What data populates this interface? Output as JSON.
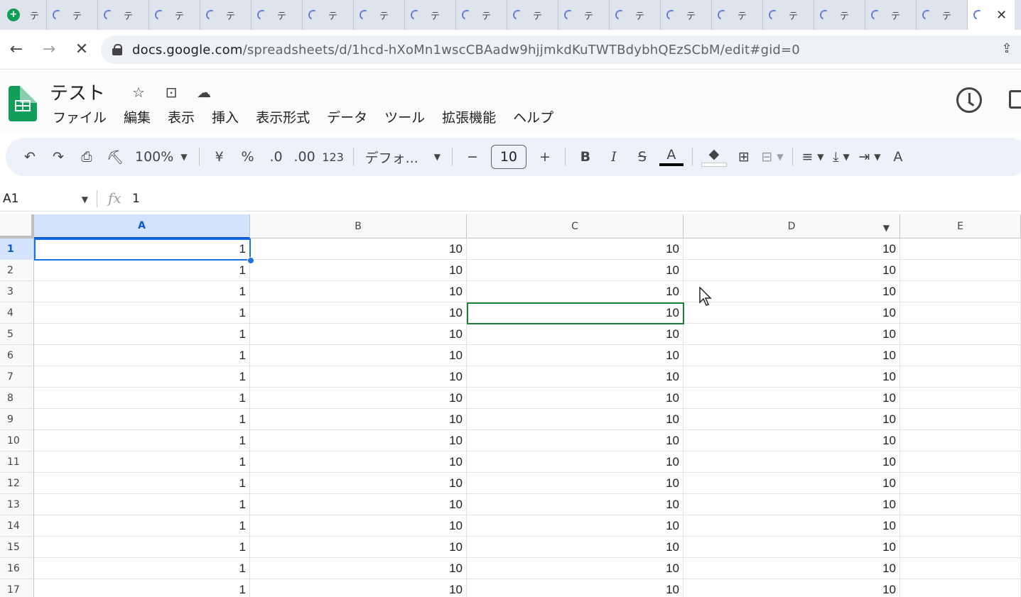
{
  "browser": {
    "tabs": [
      {
        "title": "テ",
        "loading": false,
        "active": false
      },
      {
        "title": "テ",
        "loading": true,
        "active": false
      },
      {
        "title": "テ",
        "loading": true,
        "active": false
      },
      {
        "title": "テ",
        "loading": true,
        "active": false
      },
      {
        "title": "テ",
        "loading": true,
        "active": false
      },
      {
        "title": "テ",
        "loading": true,
        "active": false
      },
      {
        "title": "テ",
        "loading": true,
        "active": false
      },
      {
        "title": "テ",
        "loading": true,
        "active": false
      },
      {
        "title": "テ",
        "loading": true,
        "active": false
      },
      {
        "title": "テ",
        "loading": true,
        "active": false
      },
      {
        "title": "テ",
        "loading": true,
        "active": false
      },
      {
        "title": "テ",
        "loading": true,
        "active": false
      },
      {
        "title": "テ",
        "loading": true,
        "active": false
      },
      {
        "title": "テ",
        "loading": true,
        "active": false
      },
      {
        "title": "テ",
        "loading": true,
        "active": false
      },
      {
        "title": "テ",
        "loading": true,
        "active": false
      },
      {
        "title": "テ",
        "loading": true,
        "active": false
      },
      {
        "title": "テ",
        "loading": true,
        "active": false
      },
      {
        "title": "テ",
        "loading": true,
        "active": false
      }
    ],
    "url_host": "docs.google.com",
    "url_path": "/spreadsheets/d/1hcd-hXoMn1wscCBAadw9hjjmkdKuTWTBdybhQEzSCbM/edit#gid=0",
    "icons": {
      "back": "←",
      "forward": "→",
      "stop": "✕",
      "close_tab": "✕",
      "share": "⇪"
    }
  },
  "doc": {
    "title": "テスト",
    "menu": [
      "ファイル",
      "編集",
      "表示",
      "挿入",
      "表示形式",
      "データ",
      "ツール",
      "拡張機能",
      "ヘルプ"
    ]
  },
  "toolbar": {
    "undo": "↶",
    "redo": "↷",
    "print": "⎙",
    "paint_format": "⛏",
    "zoom": "100%",
    "currency": "¥",
    "percent": "%",
    "decrease_decimal": ".0",
    "increase_decimal": ".00",
    "more_formats": "123",
    "font": "デフォ...",
    "font_minus": "−",
    "font_size": "10",
    "font_plus": "+",
    "bold": "B",
    "italic": "I",
    "strikethrough": "S",
    "text_color": "A",
    "fill_color": "◆",
    "borders": "⊞",
    "merge": "⊟",
    "align": "≡",
    "valign": "⤓",
    "wrap": "⇥",
    "rotate": "A"
  },
  "formula_bar": {
    "name_box": "A1",
    "fx": "fx",
    "value": "1"
  },
  "grid": {
    "columns": [
      "A",
      "B",
      "C",
      "D",
      "E"
    ],
    "selected_column": "A",
    "rows": [
      {
        "n": "1",
        "cells": [
          "1",
          "10",
          "10",
          "10"
        ]
      },
      {
        "n": "2",
        "cells": [
          "1",
          "10",
          "10",
          "10"
        ]
      },
      {
        "n": "3",
        "cells": [
          "1",
          "10",
          "10",
          "10"
        ]
      },
      {
        "n": "4",
        "cells": [
          "1",
          "10",
          "10",
          "10"
        ]
      },
      {
        "n": "5",
        "cells": [
          "1",
          "10",
          "10",
          "10"
        ]
      },
      {
        "n": "6",
        "cells": [
          "1",
          "10",
          "10",
          "10"
        ]
      },
      {
        "n": "7",
        "cells": [
          "1",
          "10",
          "10",
          "10"
        ]
      },
      {
        "n": "8",
        "cells": [
          "1",
          "10",
          "10",
          "10"
        ]
      },
      {
        "n": "9",
        "cells": [
          "1",
          "10",
          "10",
          "10"
        ]
      },
      {
        "n": "10",
        "cells": [
          "1",
          "10",
          "10",
          "10"
        ]
      },
      {
        "n": "11",
        "cells": [
          "1",
          "10",
          "10",
          "10"
        ]
      },
      {
        "n": "12",
        "cells": [
          "1",
          "10",
          "10",
          "10"
        ]
      },
      {
        "n": "13",
        "cells": [
          "1",
          "10",
          "10",
          "10"
        ]
      },
      {
        "n": "14",
        "cells": [
          "1",
          "10",
          "10",
          "10"
        ]
      },
      {
        "n": "15",
        "cells": [
          "1",
          "10",
          "10",
          "10"
        ]
      },
      {
        "n": "16",
        "cells": [
          "1",
          "10",
          "10",
          "10"
        ]
      },
      {
        "n": "17",
        "cells": [
          "1",
          "10",
          "10",
          "10"
        ]
      }
    ],
    "colors": {
      "selection": "#1a73e8",
      "collaborator": "#188038",
      "header_selected": "#d3e3fd"
    }
  }
}
